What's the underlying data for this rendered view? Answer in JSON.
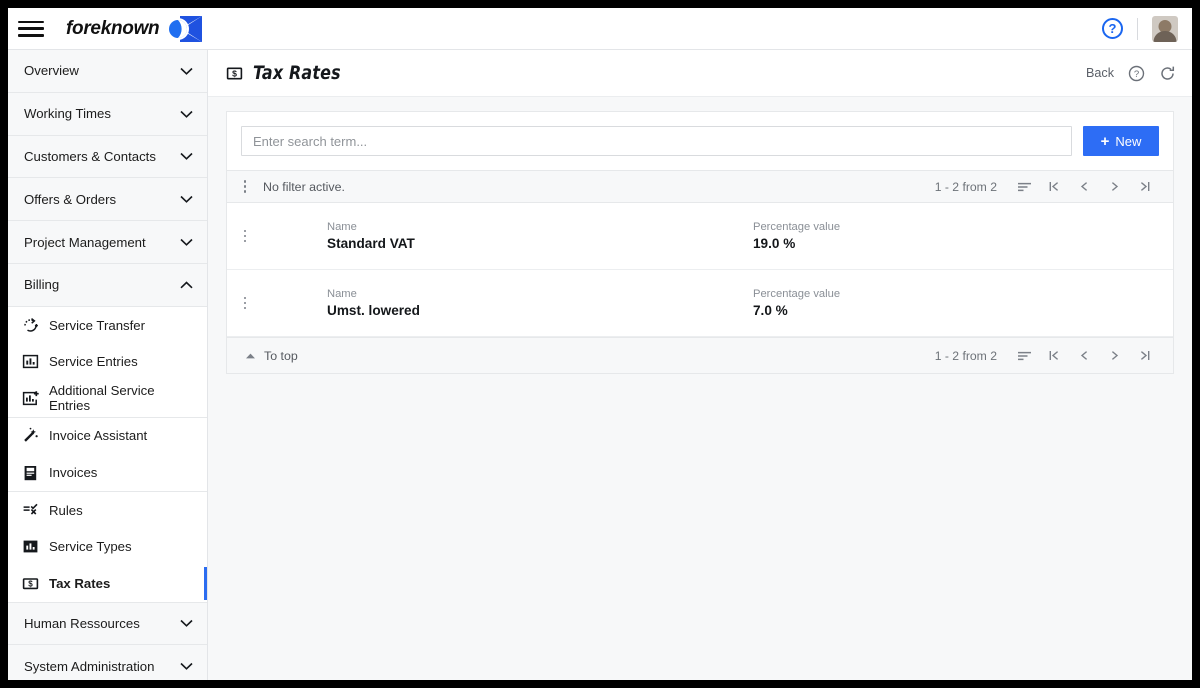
{
  "topbar": {
    "menu_icon": "hamburger-icon",
    "brand_name": "foreknown",
    "brand_logo_icon": "foreknown-logo-icon",
    "help_icon_label": "?",
    "avatar_icon": "user-avatar"
  },
  "sidebar": {
    "groups": [
      {
        "label": "Overview",
        "expanded": false
      },
      {
        "label": "Working Times",
        "expanded": false
      },
      {
        "label": "Customers & Contacts",
        "expanded": false
      },
      {
        "label": "Offers & Orders",
        "expanded": false
      },
      {
        "label": "Project Management",
        "expanded": false
      },
      {
        "label": "Billing",
        "expanded": true
      },
      {
        "label": "Human Ressources",
        "expanded": false
      },
      {
        "label": "System Administration",
        "expanded": false
      }
    ],
    "billing_items": [
      {
        "label": "Service Transfer",
        "icon": "service-transfer-icon",
        "active": false
      },
      {
        "label": "Service Entries",
        "icon": "bar-chart-box-icon",
        "active": false
      },
      {
        "label": "Additional Service Entries",
        "icon": "bar-chart-plus-icon",
        "active": false
      },
      {
        "label": "Invoice Assistant",
        "icon": "magic-wand-icon",
        "active": false
      },
      {
        "label": "Invoices",
        "icon": "invoice-icon",
        "active": false
      },
      {
        "label": "Rules",
        "icon": "rules-icon",
        "active": false
      },
      {
        "label": "Service Types",
        "icon": "bar-chart-icon",
        "active": false
      },
      {
        "label": "Tax Rates",
        "icon": "banknote-icon",
        "active": true
      }
    ]
  },
  "page": {
    "title": "Tax Rates",
    "title_icon": "banknote-icon",
    "back_label": "Back",
    "help_icon": "help-circle-icon",
    "refresh_icon": "refresh-icon"
  },
  "search": {
    "placeholder": "Enter search term...",
    "value": "",
    "new_label": "New",
    "new_icon": "plus-icon"
  },
  "filterbar": {
    "menu_icon": "kebab-menu-icon",
    "text": "No filter active.",
    "count": "1 - 2 from 2",
    "sort_icon": "sort-icon",
    "first_icon": "first-page-icon",
    "prev_icon": "prev-page-icon",
    "next_icon": "next-page-icon",
    "last_icon": "last-page-icon"
  },
  "table": {
    "columns": {
      "name": "Name",
      "percentage": "Percentage value"
    },
    "rows": [
      {
        "name": "Standard VAT",
        "percentage": "19.0 %"
      },
      {
        "name": "Umst. lowered",
        "percentage": "7.0 %"
      }
    ]
  },
  "footerbar": {
    "to_top_label": "To top",
    "to_top_icon": "caret-up-icon",
    "count": "1 - 2 from 2",
    "sort_icon": "sort-icon",
    "first_icon": "first-page-icon",
    "prev_icon": "prev-page-icon",
    "next_icon": "next-page-icon",
    "last_icon": "last-page-icon"
  },
  "colors": {
    "accent": "#2d6df5",
    "panel_bg": "#f7f8f9",
    "border": "#e6e8ea",
    "text": "#14171a",
    "muted": "#8a8f96"
  }
}
